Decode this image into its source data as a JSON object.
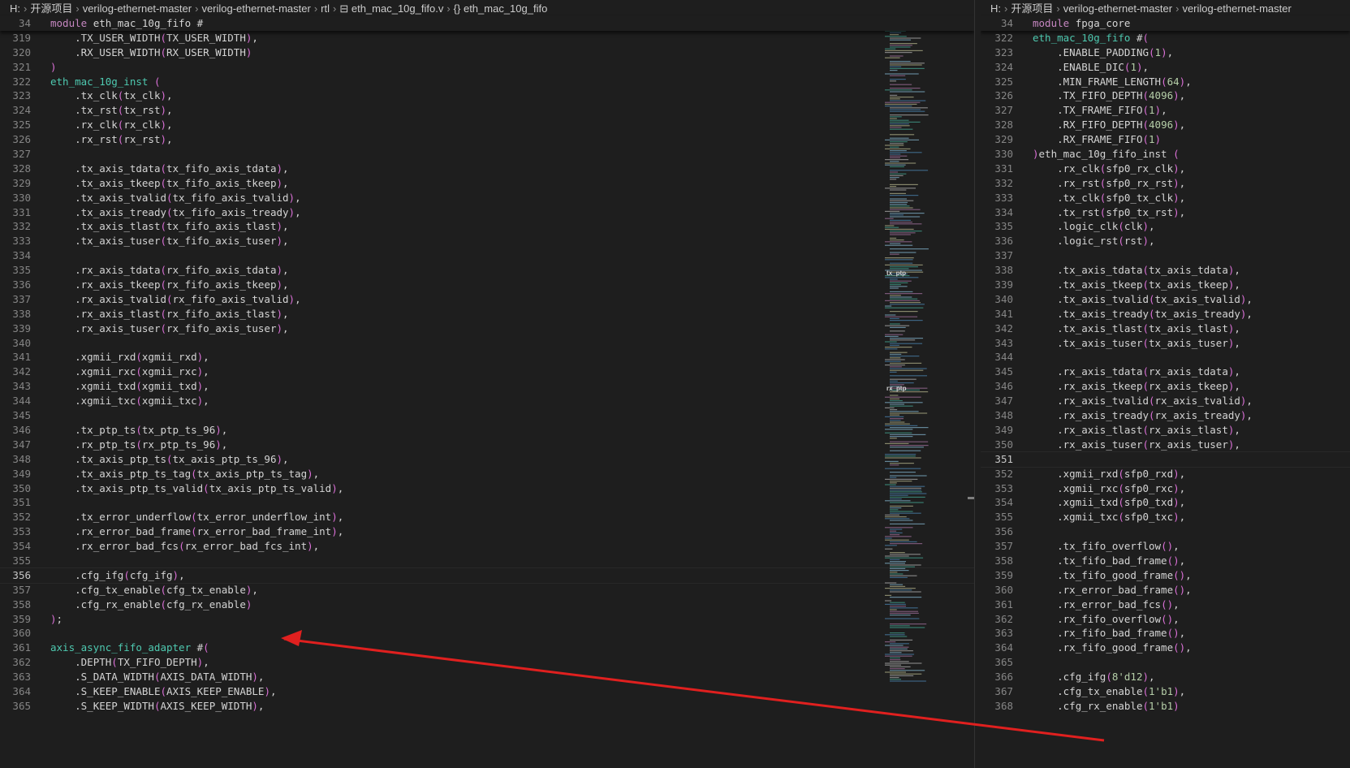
{
  "left_editor": {
    "breadcrumb": [
      {
        "label": "H:"
      },
      {
        "label": "开源项目"
      },
      {
        "label": "verilog-ethernet-master"
      },
      {
        "label": "verilog-ethernet-master"
      },
      {
        "label": "rtl"
      },
      {
        "label": "⊟ eth_mac_10g_fifo.v"
      },
      {
        "label": "{} eth_mac_10g_fifo"
      }
    ],
    "active_line": "356",
    "lines": [
      {
        "n": "34",
        "t": "module eth_mac_10g_fifo #"
      },
      {
        "n": "319",
        "t": "    .TX_USER_WIDTH(TX_USER_WIDTH),"
      },
      {
        "n": "320",
        "t": "    .RX_USER_WIDTH(RX_USER_WIDTH)"
      },
      {
        "n": "321",
        "t": ")"
      },
      {
        "n": "322",
        "t": "eth_mac_10g_inst ("
      },
      {
        "n": "323",
        "t": "    .tx_clk(tx_clk),"
      },
      {
        "n": "324",
        "t": "    .tx_rst(tx_rst),"
      },
      {
        "n": "325",
        "t": "    .rx_clk(rx_clk),"
      },
      {
        "n": "326",
        "t": "    .rx_rst(rx_rst),"
      },
      {
        "n": "327",
        "t": ""
      },
      {
        "n": "328",
        "t": "    .tx_axis_tdata(tx_fifo_axis_tdata),"
      },
      {
        "n": "329",
        "t": "    .tx_axis_tkeep(tx_fifo_axis_tkeep),"
      },
      {
        "n": "330",
        "t": "    .tx_axis_tvalid(tx_fifo_axis_tvalid),"
      },
      {
        "n": "331",
        "t": "    .tx_axis_tready(tx_fifo_axis_tready),"
      },
      {
        "n": "332",
        "t": "    .tx_axis_tlast(tx_fifo_axis_tlast),"
      },
      {
        "n": "333",
        "t": "    .tx_axis_tuser(tx_fifo_axis_tuser),"
      },
      {
        "n": "334",
        "t": ""
      },
      {
        "n": "335",
        "t": "    .rx_axis_tdata(rx_fifo_axis_tdata),"
      },
      {
        "n": "336",
        "t": "    .rx_axis_tkeep(rx_fifo_axis_tkeep),"
      },
      {
        "n": "337",
        "t": "    .rx_axis_tvalid(rx_fifo_axis_tvalid),"
      },
      {
        "n": "338",
        "t": "    .rx_axis_tlast(rx_fifo_axis_tlast),"
      },
      {
        "n": "339",
        "t": "    .rx_axis_tuser(rx_fifo_axis_tuser),"
      },
      {
        "n": "340",
        "t": ""
      },
      {
        "n": "341",
        "t": "    .xgmii_rxd(xgmii_rxd),"
      },
      {
        "n": "342",
        "t": "    .xgmii_rxc(xgmii_rxc),"
      },
      {
        "n": "343",
        "t": "    .xgmii_txd(xgmii_txd),"
      },
      {
        "n": "344",
        "t": "    .xgmii_txc(xgmii_txc),"
      },
      {
        "n": "345",
        "t": ""
      },
      {
        "n": "346",
        "t": "    .tx_ptp_ts(tx_ptp_ts_96),"
      },
      {
        "n": "347",
        "t": "    .rx_ptp_ts(rx_ptp_ts_96),"
      },
      {
        "n": "348",
        "t": "    .tx_axis_ptp_ts(tx_axis_ptp_ts_96),"
      },
      {
        "n": "349",
        "t": "    .tx_axis_ptp_ts_tag(tx_axis_ptp_ts_tag),"
      },
      {
        "n": "350",
        "t": "    .tx_axis_ptp_ts_valid(tx_axis_ptp_ts_valid),"
      },
      {
        "n": "351",
        "t": ""
      },
      {
        "n": "352",
        "t": "    .tx_error_underflow(tx_error_underflow_int),"
      },
      {
        "n": "353",
        "t": "    .rx_error_bad_frame(rx_error_bad_frame_int),"
      },
      {
        "n": "354",
        "t": "    .rx_error_bad_fcs(rx_error_bad_fcs_int),"
      },
      {
        "n": "355",
        "t": ""
      },
      {
        "n": "356",
        "t": "    .cfg_ifg(cfg_ifg),"
      },
      {
        "n": "357",
        "t": "    .cfg_tx_enable(cfg_tx_enable),"
      },
      {
        "n": "358",
        "t": "    .cfg_rx_enable(cfg_rx_enable)"
      },
      {
        "n": "359",
        "t": ");"
      },
      {
        "n": "360",
        "t": ""
      },
      {
        "n": "361",
        "t": "axis_async_fifo_adapter #("
      },
      {
        "n": "362",
        "t": "    .DEPTH(TX_FIFO_DEPTH),"
      },
      {
        "n": "363",
        "t": "    .S_DATA_WIDTH(AXIS_DATA_WIDTH),"
      },
      {
        "n": "364",
        "t": "    .S_KEEP_ENABLE(AXIS_KEEP_ENABLE),"
      },
      {
        "n": "365",
        "t": "    .S_KEEP_WIDTH(AXIS_KEEP_WIDTH),"
      }
    ]
  },
  "right_editor": {
    "breadcrumb": [
      {
        "label": "H:"
      },
      {
        "label": "开源项目"
      },
      {
        "label": "verilog-ethernet-master"
      },
      {
        "label": "verilog-ethernet-master"
      }
    ],
    "active_line": "351",
    "lines": [
      {
        "n": "34",
        "t": "module fpga_core"
      },
      {
        "n": "322",
        "t": "eth_mac_10g_fifo #("
      },
      {
        "n": "323",
        "t": "    .ENABLE_PADDING(1),"
      },
      {
        "n": "324",
        "t": "    .ENABLE_DIC(1),"
      },
      {
        "n": "325",
        "t": "    .MIN_FRAME_LENGTH(64),"
      },
      {
        "n": "326",
        "t": "    .TX_FIFO_DEPTH(4096),"
      },
      {
        "n": "327",
        "t": "    .TX_FRAME_FIFO(1),"
      },
      {
        "n": "328",
        "t": "    .RX_FIFO_DEPTH(4096),"
      },
      {
        "n": "329",
        "t": "    .RX_FRAME_FIFO(1)"
      },
      {
        "n": "330",
        "t": ")eth_mac_10g_fifo_inst ("
      },
      {
        "n": "331",
        "t": "    .rx_clk(sfp0_rx_clk),"
      },
      {
        "n": "332",
        "t": "    .rx_rst(sfp0_rx_rst),"
      },
      {
        "n": "333",
        "t": "    .tx_clk(sfp0_tx_clk),"
      },
      {
        "n": "334",
        "t": "    .tx_rst(sfp0_tx_rst),"
      },
      {
        "n": "335",
        "t": "    .logic_clk(clk),"
      },
      {
        "n": "336",
        "t": "    .logic_rst(rst),"
      },
      {
        "n": "337",
        "t": ""
      },
      {
        "n": "338",
        "t": "    .tx_axis_tdata(tx_axis_tdata),"
      },
      {
        "n": "339",
        "t": "    .tx_axis_tkeep(tx_axis_tkeep),"
      },
      {
        "n": "340",
        "t": "    .tx_axis_tvalid(tx_axis_tvalid),"
      },
      {
        "n": "341",
        "t": "    .tx_axis_tready(tx_axis_tready),"
      },
      {
        "n": "342",
        "t": "    .tx_axis_tlast(tx_axis_tlast),"
      },
      {
        "n": "343",
        "t": "    .tx_axis_tuser(tx_axis_tuser),"
      },
      {
        "n": "344",
        "t": ""
      },
      {
        "n": "345",
        "t": "    .rx_axis_tdata(rx_axis_tdata),"
      },
      {
        "n": "346",
        "t": "    .rx_axis_tkeep(rx_axis_tkeep),"
      },
      {
        "n": "347",
        "t": "    .rx_axis_tvalid(rx_axis_tvalid),"
      },
      {
        "n": "348",
        "t": "    .rx_axis_tready(rx_axis_tready),"
      },
      {
        "n": "349",
        "t": "    .rx_axis_tlast(rx_axis_tlast),"
      },
      {
        "n": "350",
        "t": "    .rx_axis_tuser(rx_axis_tuser),"
      },
      {
        "n": "351",
        "t": ""
      },
      {
        "n": "352",
        "t": "    .xgmii_rxd(sfp0_rxd),"
      },
      {
        "n": "353",
        "t": "    .xgmii_rxc(sfp0_rxc),"
      },
      {
        "n": "354",
        "t": "    .xgmii_txd(sfp0_txd),"
      },
      {
        "n": "355",
        "t": "    .xgmii_txc(sfp0_txc),"
      },
      {
        "n": "356",
        "t": ""
      },
      {
        "n": "357",
        "t": "    .tx_fifo_overflow(),"
      },
      {
        "n": "358",
        "t": "    .tx_fifo_bad_frame(),"
      },
      {
        "n": "359",
        "t": "    .tx_fifo_good_frame(),"
      },
      {
        "n": "360",
        "t": "    .rx_error_bad_frame(),"
      },
      {
        "n": "361",
        "t": "    .rx_error_bad_fcs(),"
      },
      {
        "n": "362",
        "t": "    .rx_fifo_overflow(),"
      },
      {
        "n": "363",
        "t": "    .rx_fifo_bad_frame(),"
      },
      {
        "n": "364",
        "t": "    .rx_fifo_good_frame(),"
      },
      {
        "n": "365",
        "t": ""
      },
      {
        "n": "366",
        "t": "    .cfg_ifg(8'd12),"
      },
      {
        "n": "367",
        "t": "    .cfg_tx_enable(1'b1),"
      },
      {
        "n": "368",
        "t": "    .cfg_rx_enable(1'b1)"
      }
    ]
  },
  "minimap": {
    "labels": [
      {
        "text": "tx_ptp"
      },
      {
        "text": "rx_ptp"
      }
    ]
  },
  "colors": {
    "background": "#1e1e1e",
    "line_number": "#858585",
    "keyword": "#c586c0",
    "type": "#4ec9b0",
    "function": "#dcdcaa",
    "paren_outer": "#da70d6",
    "paren_inner": "#179fff",
    "number": "#b5cea8",
    "annotation_arrow": "#e0201f"
  }
}
